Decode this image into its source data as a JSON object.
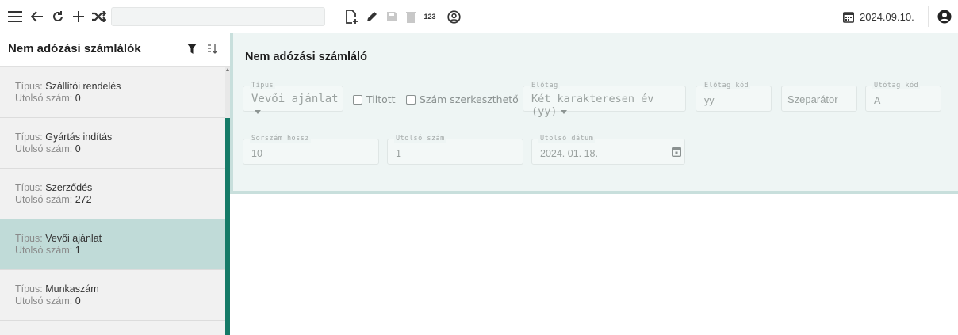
{
  "toolbar": {
    "icons": [
      "menu-icon",
      "back-icon",
      "reload-icon",
      "add-icon",
      "shuffle-icon",
      "new-document-icon",
      "edit-icon",
      "save-icon",
      "delete-icon",
      "numbering-icon",
      "user-circle-icon",
      "calendar-icon",
      "account-icon"
    ],
    "numbering_label": "123",
    "date": "2024.09.10."
  },
  "sidebar": {
    "title": "Nem adózási számlálók",
    "items": [
      {
        "type_key": "Típus:",
        "type": "Szállítói rendelés",
        "last_key": "Utolsó szám:",
        "last": "0",
        "active": false
      },
      {
        "type_key": "Típus:",
        "type": "Gyártás indítás",
        "last_key": "Utolsó szám:",
        "last": "0",
        "active": false
      },
      {
        "type_key": "Típus:",
        "type": "Szerződés",
        "last_key": "Utolsó szám:",
        "last": "272",
        "active": false
      },
      {
        "type_key": "Típus:",
        "type": "Vevői ajánlat",
        "last_key": "Utolsó szám:",
        "last": "1",
        "active": true
      },
      {
        "type_key": "Típus:",
        "type": "Munkaszám",
        "last_key": "Utolsó szám:",
        "last": "0",
        "active": false
      }
    ]
  },
  "form": {
    "title": "Nem adózási számláló",
    "tipus": {
      "label": "Típus",
      "value": "Vevői ajánlat"
    },
    "tiltott": {
      "label": "Tiltott",
      "checked": false
    },
    "szerkesztheto": {
      "label": "Szám szerkeszthető",
      "checked": false
    },
    "elotag": {
      "label": "Előtag",
      "value": "Két karakteresen év (yy)"
    },
    "elotag_kod": {
      "label": "Előtag kód",
      "value": "yy"
    },
    "szeparator": {
      "value": "Szeparátor"
    },
    "utotag_kod": {
      "label": "Utótag kód",
      "value": "A"
    },
    "sorszam_hossz": {
      "label": "Sorszám hossz",
      "value": "10"
    },
    "utolso_szam": {
      "label": "Utolsó szám",
      "value": "1"
    },
    "utolso_datum": {
      "label": "Utolsó dátum",
      "value": "2024. 01. 18."
    }
  },
  "colors": {
    "accent": "#157a67",
    "active_row": "#c0dbd8",
    "panel_bg": "#eef5f4"
  }
}
